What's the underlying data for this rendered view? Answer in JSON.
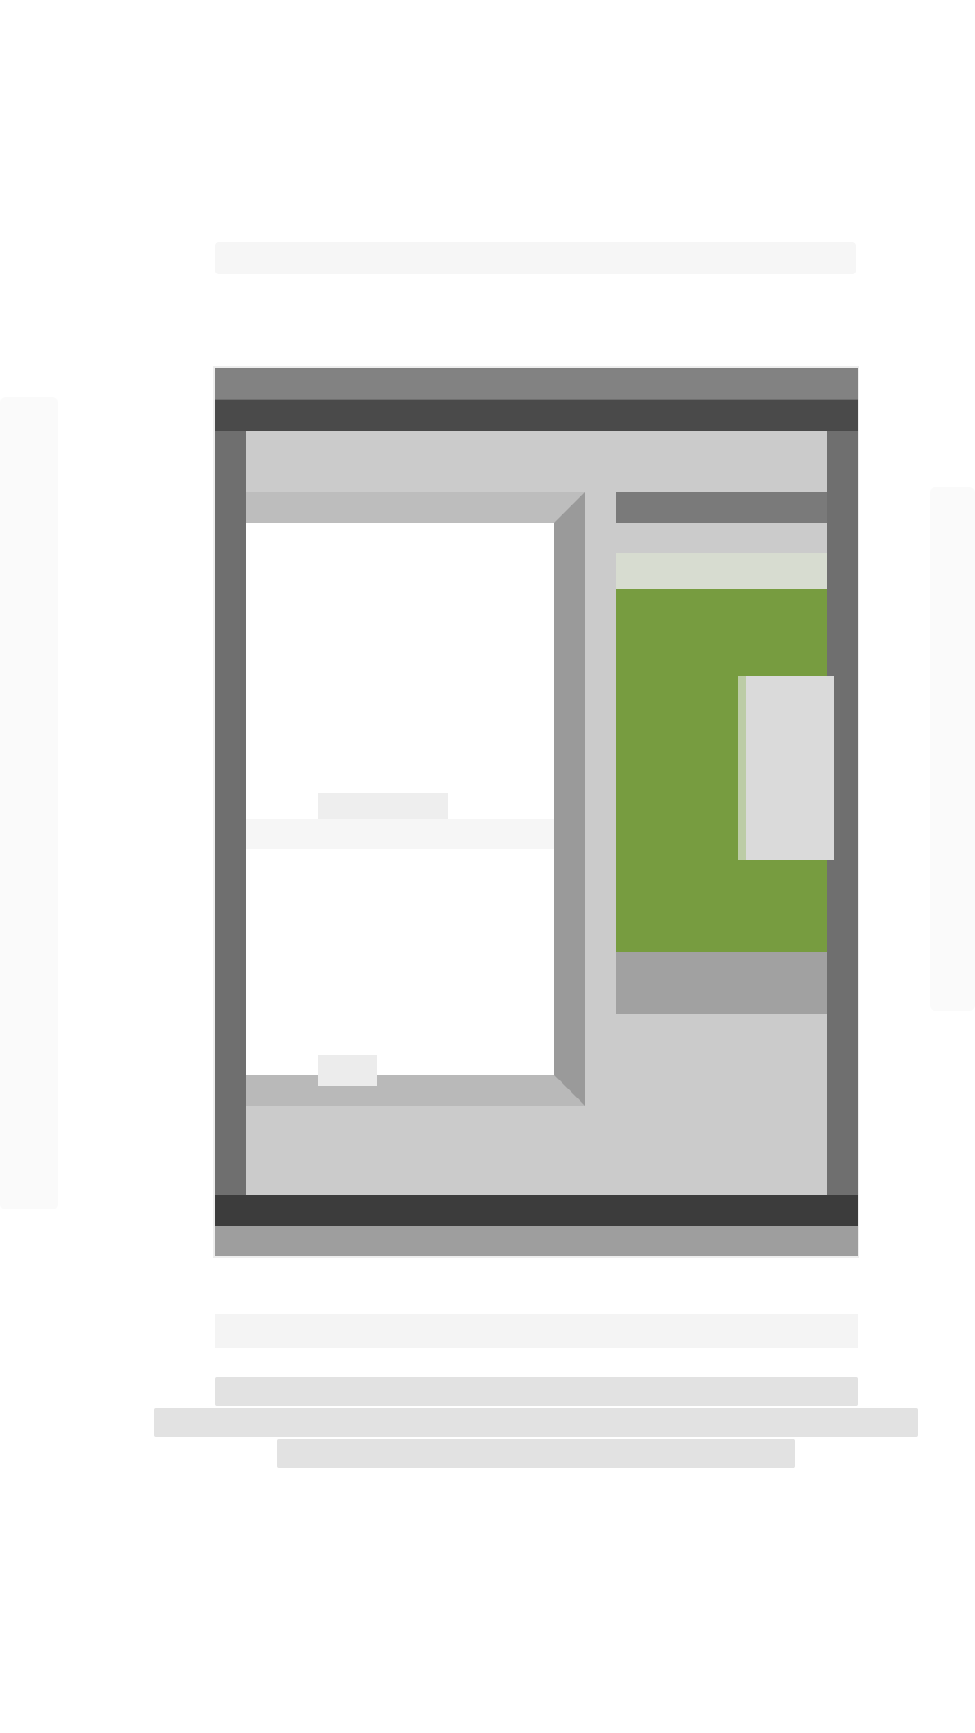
{
  "page": {
    "heading": "",
    "caption": "",
    "description": ""
  },
  "illustration": {
    "doc_line": "",
    "doc_tag": ""
  },
  "colors": {
    "accent": "#779c40",
    "frame": "#6f6f6f",
    "background": "#ffffff"
  }
}
